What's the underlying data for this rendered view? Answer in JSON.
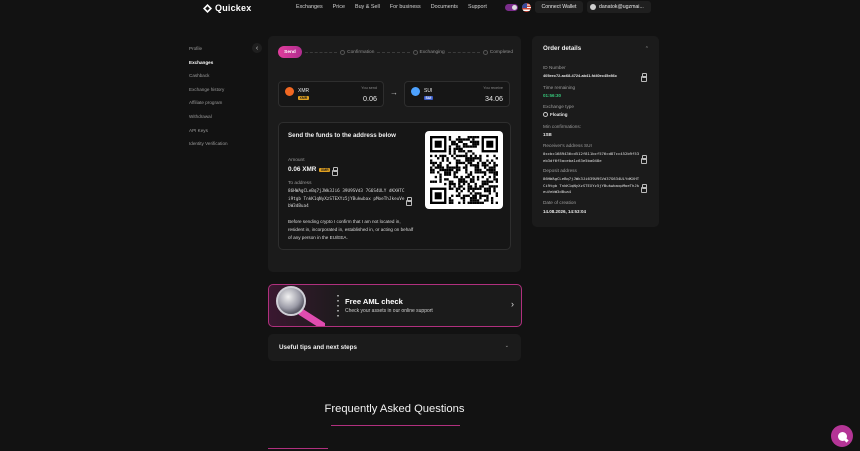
{
  "header": {
    "logo": "Quickex",
    "nav": [
      "Exchanges",
      "Price",
      "Buy & Sell",
      "For business",
      "Documents",
      "Support"
    ],
    "connect_wallet": "Connect Wallet",
    "user_email": "danatok@ugzmai..."
  },
  "sidebar": {
    "items": [
      "Profile",
      "Exchanges",
      "Cashback",
      "Exchange history",
      "Affiliate program",
      "Withdrawal",
      "API Keys",
      "Identity Verification"
    ],
    "active": "Exchanges"
  },
  "steps": {
    "active": "Send",
    "items": [
      "Confirmation",
      "Exchanging",
      "Completed"
    ]
  },
  "exchange": {
    "from": {
      "ticker": "XMR",
      "network": "XMR",
      "label": "You send",
      "amount": "0.06",
      "color": "#f26822",
      "badge_color": "#e0a020"
    },
    "to": {
      "ticker": "SUI",
      "network": "SUI",
      "label": "You receive",
      "amount": "34.06",
      "color": "#4da2ff",
      "badge_color": "#3a5cc8"
    }
  },
  "send": {
    "title": "Send the funds to the address below",
    "amount_label": "Amount",
    "amount_value": "0.06 XMR",
    "amount_badge": "XMR",
    "to_label": "To address",
    "address": "86HWAgCLeBq7jJWk3Ji6 39U9SVd3 7G6S4ULY dKXHTCi9tgb TnkK1qNyXzSTEXYz5jYBukwbax pMoeThJkeuVebW3dBua4",
    "disclaimer": "Before sending crypto I confirm that I am not located in, resident in, incorporated in, established in, or acting on behalf of any person in the EU/EEA."
  },
  "order": {
    "title": "Order details",
    "id_label": "ID Number",
    "id_value": "405eec72-ac68-4724-ab41-fd40ec45e86c",
    "time_label": "Time remaining",
    "time_value": "01:56:30",
    "type_label": "Exchange type",
    "type_value": "Floating",
    "conf_label": "Min confirmations:",
    "conf_value": "1SB",
    "recv_label": "Receiver's address SUI",
    "recv_value": "0xcbc1689436cd512f811bcf576cd87cc452b9f53eb3df6f5aceba1c63e5ba048e",
    "deposit_label": "Deposit address",
    "deposit_value": "86HWAgCLeBq7jJWk3Ji639U9SVd37G634ULYdKXHTCi9tgb TnkK1qNyXzSTEXYz5jYBukwbaxpMoeThJkeuVebW3dBua4",
    "date_label": "Date of creation",
    "date_value": "14.08.2026, 14:53:04"
  },
  "aml": {
    "title": "Free AML check",
    "subtitle": "Check your assets in our online support"
  },
  "tips": {
    "title": "Useful tips and next steps"
  },
  "faq": {
    "title": "Frequently Asked Questions"
  },
  "colors": {
    "accent": "#e13d9c",
    "background": "#121212",
    "card": "#1b1b1b",
    "timer": "#36c77a"
  }
}
